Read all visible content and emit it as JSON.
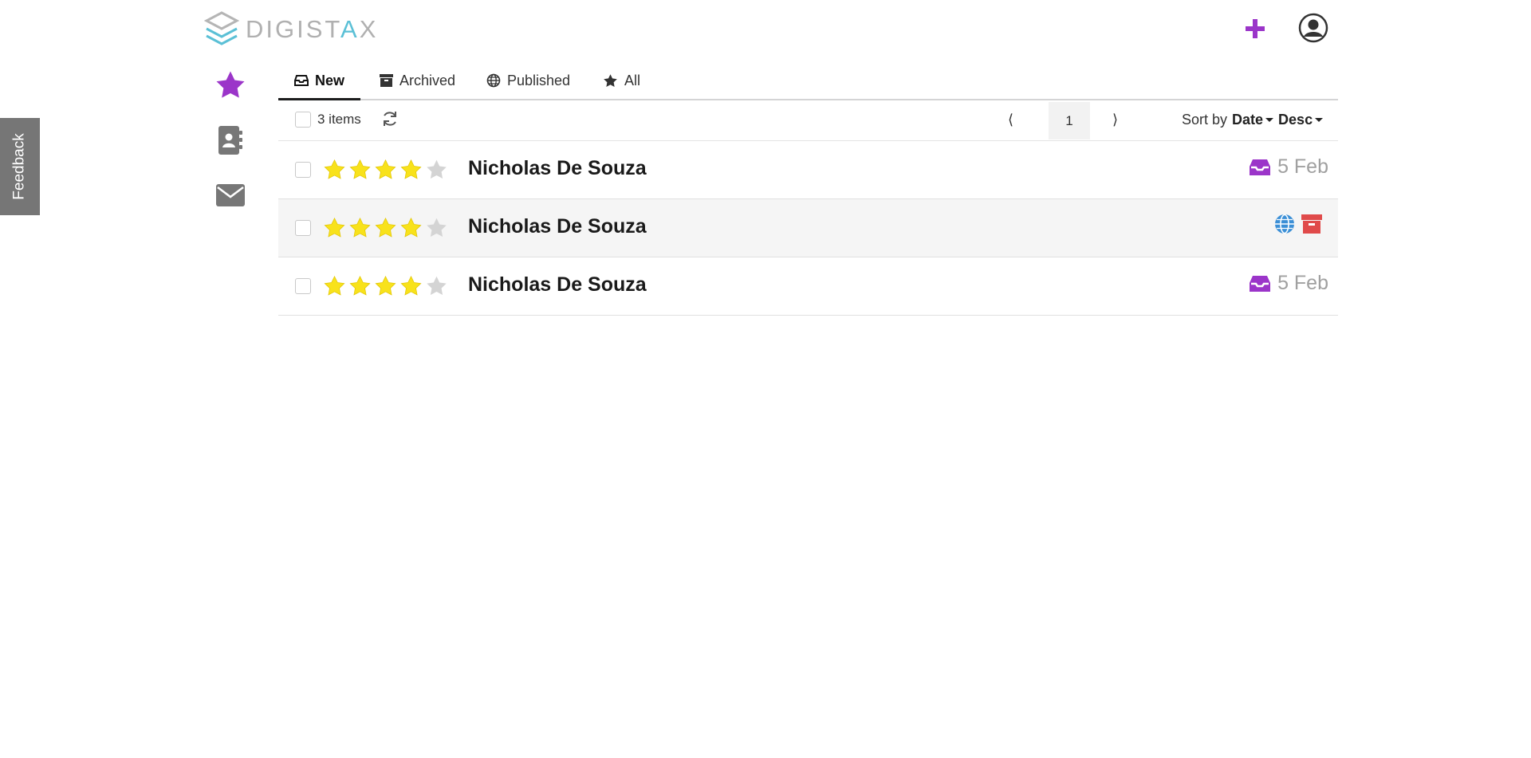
{
  "app": {
    "logo_text_main": "DIGIST",
    "logo_text_accent": "A",
    "logo_text_end": "X",
    "feedback_label": "Feedback"
  },
  "colors": {
    "brand_purple": "#9b35c9",
    "star_yellow": "#f8e21b",
    "star_empty": "#d4d4d4",
    "published_blue": "#3b8fd6",
    "archived_red": "#e04a4a",
    "rail_grey": "#777777"
  },
  "header": {
    "add_icon": "plus-icon",
    "avatar_icon": "user-circle-icon"
  },
  "sidebar": {
    "items": [
      {
        "icon": "star-icon",
        "active": true
      },
      {
        "icon": "address-book-icon",
        "active": false
      },
      {
        "icon": "envelope-icon",
        "active": false
      }
    ]
  },
  "tabs": [
    {
      "label": "New",
      "icon": "inbox-icon",
      "active": true
    },
    {
      "label": "Archived",
      "icon": "archive-icon",
      "active": false
    },
    {
      "label": "Published",
      "icon": "globe-icon",
      "active": false
    },
    {
      "label": "All",
      "icon": "star-icon",
      "active": false
    }
  ],
  "toolbar": {
    "items_count": "3 items",
    "prev_label": "⟨",
    "page": "1",
    "next_label": "⟩",
    "sort_by_label": "Sort by",
    "sort_field": "Date",
    "sort_order": "Desc"
  },
  "rows": [
    {
      "name": "Nicholas De Souza",
      "rating": 4,
      "max_rating": 5,
      "status_icons": [
        "inbox-icon"
      ],
      "date": "5 Feb"
    },
    {
      "name": "Nicholas De Souza",
      "rating": 4,
      "max_rating": 5,
      "status_icons": [
        "globe-icon",
        "archive-icon"
      ],
      "date": ""
    },
    {
      "name": "Nicholas De Souza",
      "rating": 4,
      "max_rating": 5,
      "status_icons": [
        "inbox-icon"
      ],
      "date": "5 Feb"
    }
  ]
}
